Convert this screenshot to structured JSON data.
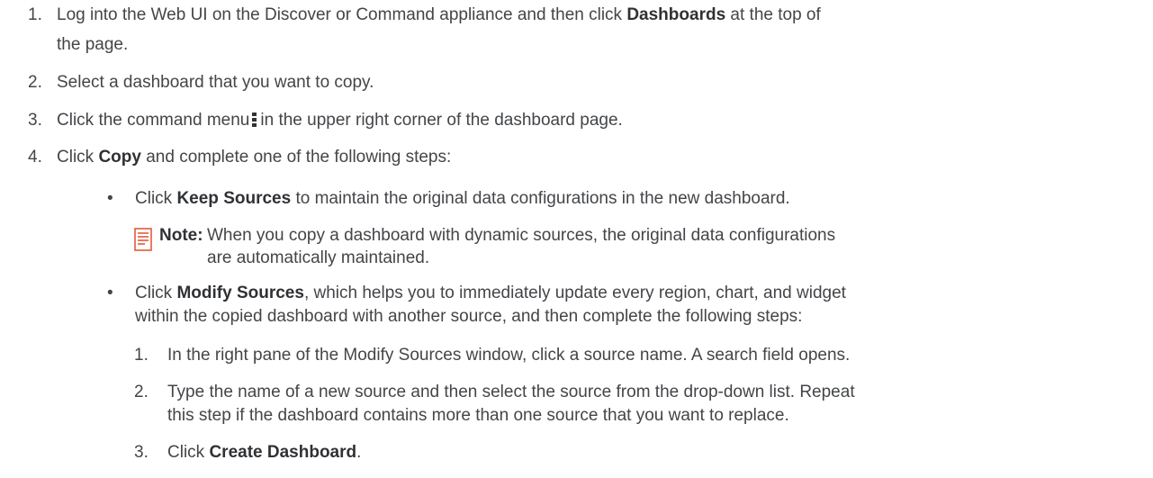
{
  "steps": [
    {
      "number": "1.",
      "line1_pre": "Log into the Web UI on the Discover or Command appliance and then click ",
      "line1_bold": "Dashboards",
      "line1_post": " at the top of",
      "line2": "the page."
    },
    {
      "number": "2.",
      "text": "Select a dashboard that you want to copy."
    },
    {
      "number": "3.",
      "pre": "Click the command menu",
      "icon": "vertical-ellipsis-icon",
      "post": "in the upper right corner of the dashboard page."
    },
    {
      "number": "4.",
      "pre": "Click ",
      "bold": "Copy",
      "post": " and complete one of the following steps:"
    }
  ],
  "bullets": [
    {
      "symbol": "•",
      "pre": "Click ",
      "bold": "Keep Sources",
      "post": " to maintain the original data configurations in the new dashboard."
    },
    {
      "symbol": "•",
      "pre": "Click ",
      "bold": "Modify Sources",
      "post": ", which helps you to immediately update every region, chart, and widget",
      "line2": "within the copied dashboard with another source, and then complete the following steps:"
    }
  ],
  "note": {
    "icon": "note-icon",
    "label": "Note:",
    "line1": "When you copy a dashboard with dynamic sources, the original data configurations",
    "line2": "are automatically maintained."
  },
  "substeps": [
    {
      "number": "1.",
      "text": "In the right pane of the Modify Sources window, click a source name. A search field opens."
    },
    {
      "number": "2.",
      "line1": "Type the name of a new source and then select the source from the drop-down list. Repeat",
      "line2": "this step if the dashboard contains more than one source that you want to replace."
    },
    {
      "number": "3.",
      "pre": "Click ",
      "bold": "Create Dashboard",
      "post": "."
    }
  ],
  "colors": {
    "text": "#434548",
    "note_icon": "#e25a3c"
  }
}
